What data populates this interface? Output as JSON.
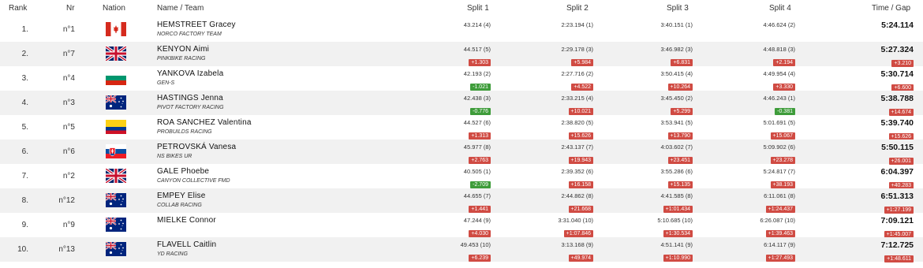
{
  "columns": {
    "rank": "Rank",
    "nr": "Nr",
    "nation": "Nation",
    "name_team": "Name / Team",
    "split1": "Split 1",
    "split2": "Split 2",
    "split3": "Split 3",
    "split4": "Split 4",
    "time_gap": "Time / Gap"
  },
  "colors": {
    "negative_gap": "#3e9c3a",
    "positive_gap": "#d04b43",
    "alt_row": "#f1f1f1"
  },
  "rows": [
    {
      "rank": "1.",
      "nr": "n°1",
      "nation": "flag-canada",
      "name": "HEMSTREET Gracey",
      "team": "NORCO FACTORY TEAM",
      "s1": "43.214 (4)",
      "s1g": "",
      "s2": "2:23.194 (1)",
      "s2g": "",
      "s3": "3:40.151 (1)",
      "s3g": "",
      "s4": "4:46.624 (2)",
      "s4g": "",
      "time": "5:24.114",
      "gap": ""
    },
    {
      "rank": "2.",
      "nr": "n°7",
      "nation": "flag-united-kingdom",
      "name": "KENYON Aimi",
      "team": "PINKBIKE RACING",
      "s1": "44.517 (5)",
      "s1g": "+1.303",
      "s2": "2:29.178 (3)",
      "s2g": "+5.984",
      "s3": "3:46.982 (3)",
      "s3g": "+6.831",
      "s4": "4:48.818 (3)",
      "s4g": "+2.194",
      "time": "5:27.324",
      "gap": "+3.210"
    },
    {
      "rank": "3.",
      "nr": "n°4",
      "nation": "flag-bulgaria",
      "name": "YANKOVA Izabela",
      "team": "GEN-S",
      "s1": "42.193 (2)",
      "s1g": "-1.021",
      "s2": "2:27.716 (2)",
      "s2g": "+4.522",
      "s3": "3:50.415 (4)",
      "s3g": "+10.264",
      "s4": "4:49.954 (4)",
      "s4g": "+3.330",
      "time": "5:30.714",
      "gap": "+6.600"
    },
    {
      "rank": "4.",
      "nr": "n°3",
      "nation": "flag-australia",
      "name": "HASTINGS Jenna",
      "team": "PIVOT FACTORY RACING",
      "s1": "42.438 (3)",
      "s1g": "-0.776",
      "s2": "2:33.215 (4)",
      "s2g": "+10.021",
      "s3": "3:45.450 (2)",
      "s3g": "+5.299",
      "s4": "4:46.243 (1)",
      "s4g": "-0.381",
      "time": "5:38.788",
      "gap": "+14.674"
    },
    {
      "rank": "5.",
      "nr": "n°5",
      "nation": "flag-colombia",
      "name": "ROA SANCHEZ Valentina",
      "team": "PROBUILDS RACING",
      "s1": "44.527 (6)",
      "s1g": "+1.313",
      "s2": "2:38.820 (5)",
      "s2g": "+15.626",
      "s3": "3:53.941 (5)",
      "s3g": "+13.790",
      "s4": "5:01.691 (5)",
      "s4g": "+15.067",
      "time": "5:39.740",
      "gap": "+15.626"
    },
    {
      "rank": "6.",
      "nr": "n°6",
      "nation": "flag-slovakia",
      "name": "PETROVSKÁ Vanesa",
      "team": "NS BIKES UR",
      "s1": "45.977 (8)",
      "s1g": "+2.763",
      "s2": "2:43.137 (7)",
      "s2g": "+19.943",
      "s3": "4:03.602 (7)",
      "s3g": "+23.451",
      "s4": "5:09.902 (6)",
      "s4g": "+23.278",
      "time": "5:50.115",
      "gap": "+26.001"
    },
    {
      "rank": "7.",
      "nr": "n°2",
      "nation": "flag-united-kingdom",
      "name": "GALE Phoebe",
      "team": "CANYON COLLECTIVE FMD",
      "s1": "40.505 (1)",
      "s1g": "-2.709",
      "s2": "2:39.352 (6)",
      "s2g": "+16.158",
      "s3": "3:55.286 (6)",
      "s3g": "+15.135",
      "s4": "5:24.817 (7)",
      "s4g": "+38.193",
      "time": "6:04.397",
      "gap": "+40.283"
    },
    {
      "rank": "8.",
      "nr": "n°12",
      "nation": "flag-australia",
      "name": "EMPEY Elise",
      "team": "COLLAB RACING",
      "s1": "44.655 (7)",
      "s1g": "+1.441",
      "s2": "2:44.862 (8)",
      "s2g": "+21.668",
      "s3": "4:41.585 (8)",
      "s3g": "+1:01.434",
      "s4": "6:11.061 (8)",
      "s4g": "+1:24.437",
      "time": "6:51.313",
      "gap": "+1:27.199"
    },
    {
      "rank": "9.",
      "nr": "n°9",
      "nation": "flag-australia",
      "name": "MIELKE Connor",
      "team": "",
      "s1": "47.244 (9)",
      "s1g": "+4.030",
      "s2": "3:31.040 (10)",
      "s2g": "+1:07.846",
      "s3": "5:10.685 (10)",
      "s3g": "+1:30.534",
      "s4": "6:26.087 (10)",
      "s4g": "+1:39.463",
      "time": "7:09.121",
      "gap": "+1:45.007"
    },
    {
      "rank": "10.",
      "nr": "n°13",
      "nation": "flag-australia",
      "name": "FLAVELL Caitlin",
      "team": "YD RACING",
      "s1": "49.453 (10)",
      "s1g": "+6.239",
      "s2": "3:13.168 (9)",
      "s2g": "+49.974",
      "s3": "4:51.141 (9)",
      "s3g": "+1:10.990",
      "s4": "6:14.117 (9)",
      "s4g": "+1:27.493",
      "time": "7:12.725",
      "gap": "+1:48.611"
    }
  ]
}
